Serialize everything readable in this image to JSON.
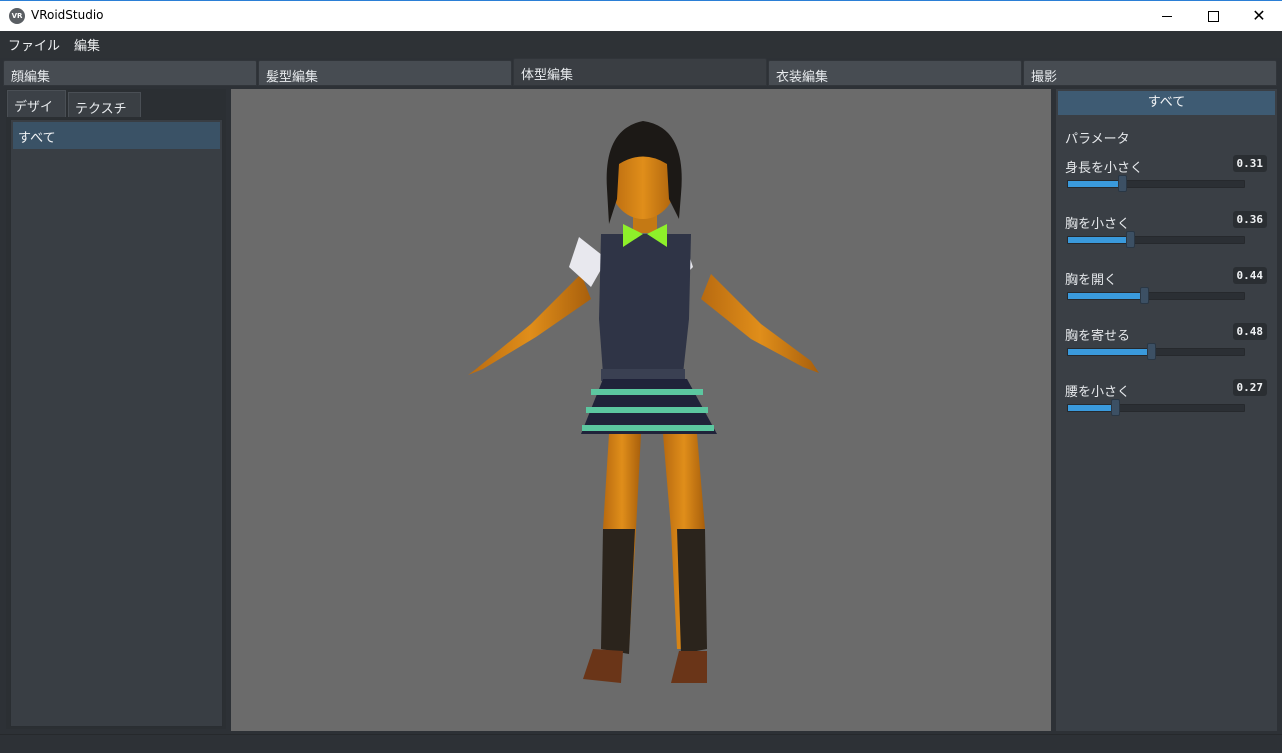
{
  "window": {
    "logo_text": "VR",
    "title": "VRoidStudio",
    "minimize": "—",
    "maximize": "☐",
    "close": "✕"
  },
  "menu": [
    "ファイル",
    "編集"
  ],
  "main_tabs": [
    {
      "label": "顔編集",
      "active": false
    },
    {
      "label": "髪型編集",
      "active": false
    },
    {
      "label": "体型編集",
      "active": true
    },
    {
      "label": "衣装編集",
      "active": false
    },
    {
      "label": "撮影",
      "active": false
    }
  ],
  "left_panel": {
    "tabs": [
      {
        "label": "デザイン",
        "active": true
      },
      {
        "label": "テクスチャ",
        "active": false
      }
    ],
    "items": [
      "すべて"
    ]
  },
  "right_panel": {
    "category_button": "すべて",
    "heading": "パラメータ",
    "params": [
      {
        "label": "身長を小さく",
        "value": "0.31",
        "fraction": 0.31
      },
      {
        "label": "胸を小さく",
        "value": "0.36",
        "fraction": 0.36
      },
      {
        "label": "胸を開く",
        "value": "0.44",
        "fraction": 0.44
      },
      {
        "label": "胸を寄せる",
        "value": "0.48",
        "fraction": 0.48
      },
      {
        "label": "腰を小さく",
        "value": "0.27",
        "fraction": 0.27
      }
    ]
  },
  "colors": {
    "accent": "#3a9adc",
    "selected_item": "#3a5266",
    "viewport_bg": "#6b6b6b"
  }
}
